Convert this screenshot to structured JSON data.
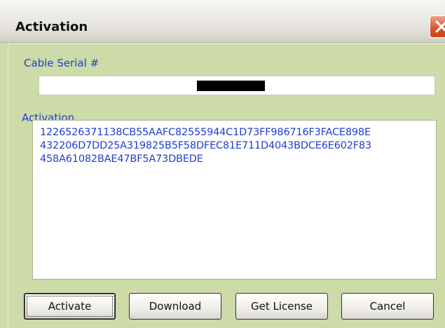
{
  "window": {
    "title": "Activation"
  },
  "serial": {
    "label": "Cable Serial #",
    "value_redacted": true
  },
  "activation": {
    "label": "Activation",
    "code_lines": [
      "1226526371138CB55AAFC82555944C1D73FF986716F3FACE898E",
      "432206D7DD25A319825B5F58DFEC81E711D4043BDCE6E602F83",
      "458A61082BAE47BF5A73DBEDE"
    ]
  },
  "buttons": {
    "activate": "Activate",
    "download": "Download",
    "get_license": "Get License",
    "cancel": "Cancel"
  },
  "colors": {
    "dialog_background": "#ccdba8",
    "label_text": "#1f3fcf",
    "close_button": "#d9582e"
  },
  "icons": {
    "close": "close-icon"
  }
}
